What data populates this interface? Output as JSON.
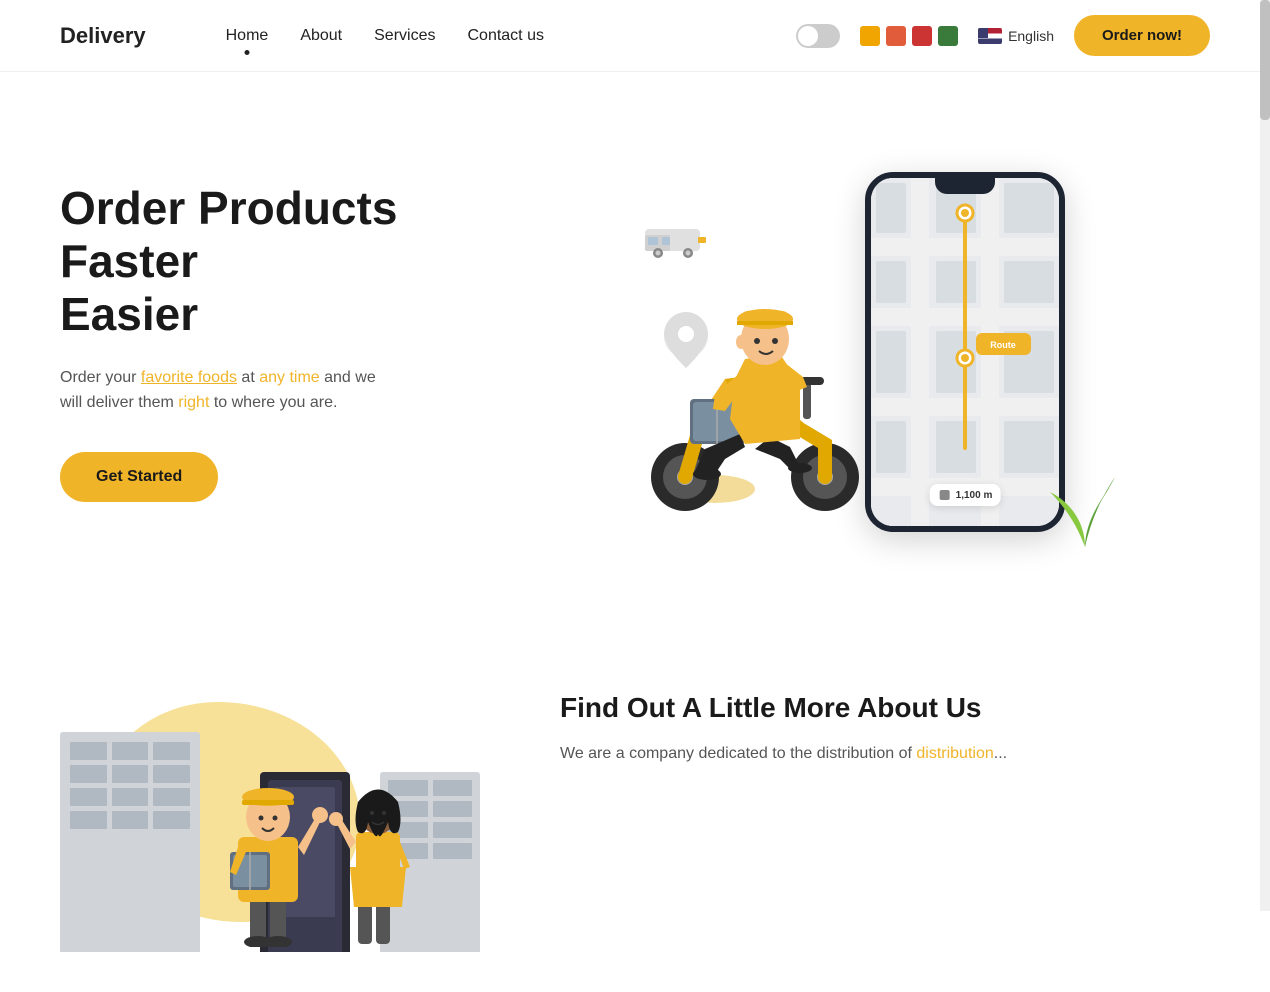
{
  "navbar": {
    "logo": "Delivery",
    "links": [
      {
        "label": "Home",
        "active": true
      },
      {
        "label": "About",
        "active": false
      },
      {
        "label": "Services",
        "active": false
      },
      {
        "label": "Contact us",
        "active": false
      }
    ],
    "lang": "English",
    "order_btn": "Order now!"
  },
  "hero": {
    "title_line1": "Order Products Faster",
    "title_line2": "Easier",
    "subtitle": "Order your favorite foods at any time and we will deliver them right to where you are.",
    "cta_btn": "Get Started",
    "distance": "1,100 m"
  },
  "about": {
    "title": "Find Out A Little More About Us",
    "text": "We are a company dedicated to the distribution of"
  },
  "swatches": [
    {
      "color": "#f0a500"
    },
    {
      "color": "#e05c3a"
    },
    {
      "color": "#cc3333"
    },
    {
      "color": "#3a7a3a"
    }
  ]
}
